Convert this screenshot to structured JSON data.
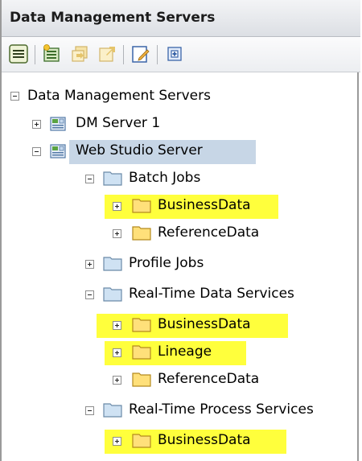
{
  "panel": {
    "title": "Data Management Servers"
  },
  "toolbar": {
    "buttons": [
      {
        "name": "menu-icon"
      },
      {
        "name": "new-server-icon"
      },
      {
        "name": "import-icon"
      },
      {
        "name": "export-icon"
      },
      {
        "name": "edit-icon"
      },
      {
        "name": "refresh-icon"
      }
    ]
  },
  "tree": {
    "root": "Data Management Servers",
    "dm_server_1": "DM Server 1",
    "web_studio_server": "Web Studio Server",
    "batch_jobs": "Batch Jobs",
    "batch_business": "BusinessData",
    "batch_reference": "ReferenceData",
    "profile_jobs": "Profile Jobs",
    "rt_data_services": "Real-Time Data Services",
    "rtds_business": "BusinessData",
    "rtds_lineage": "Lineage",
    "rtds_reference": "ReferenceData",
    "rt_process_services": "Real-Time Process Services",
    "rtps_business": "BusinessData"
  },
  "colors": {
    "highlight": "#ffff3c",
    "selection": "#c7d6e6",
    "folder_blue": "#cfe2f3",
    "folder_yellow": "#ffe07a"
  }
}
